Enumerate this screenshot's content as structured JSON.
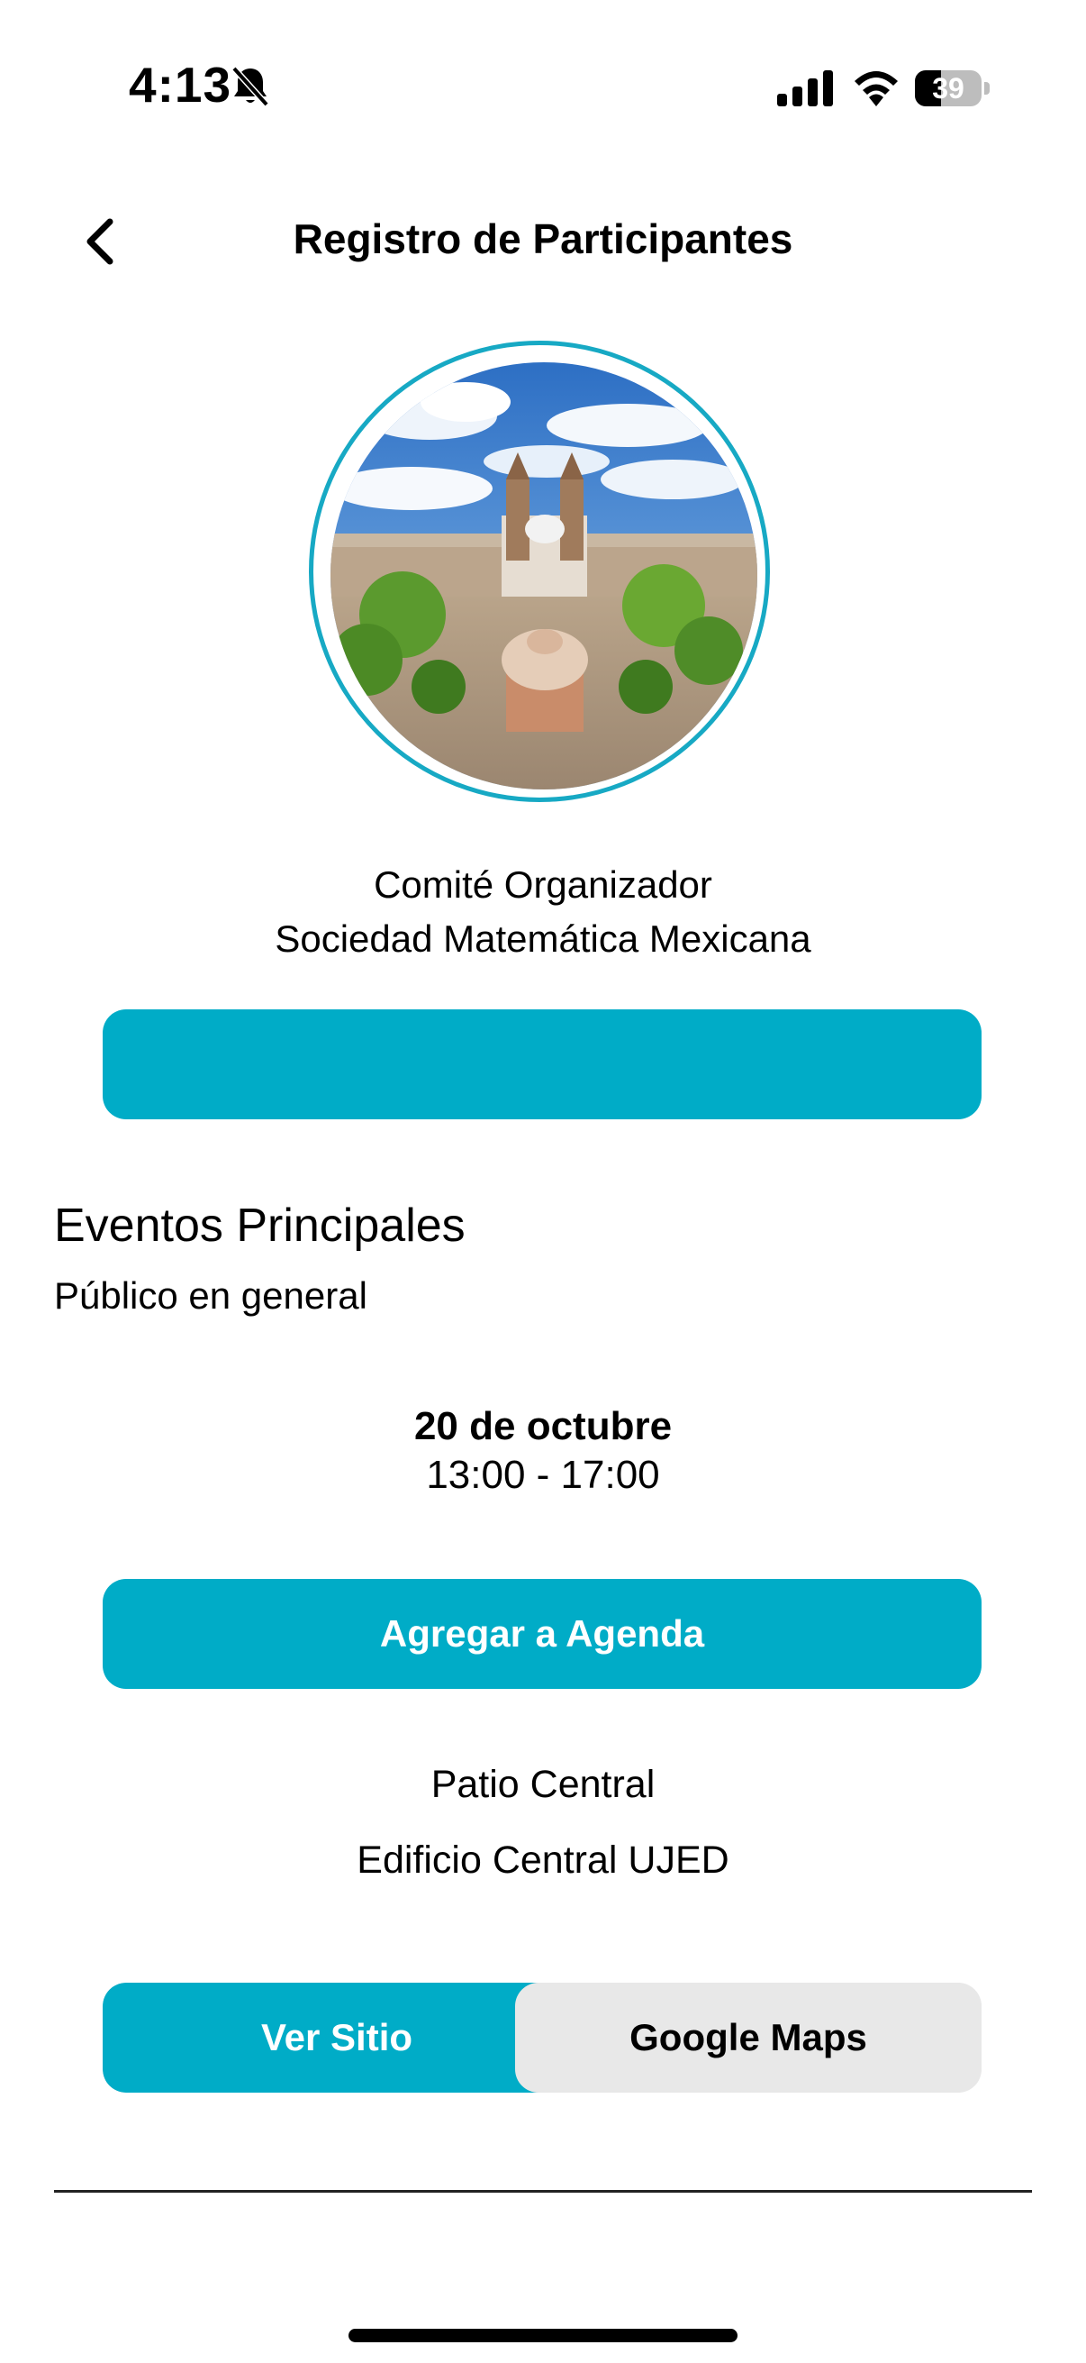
{
  "status_bar": {
    "time": "4:13",
    "battery_percent": "39",
    "battery_level": 0.39,
    "icons": [
      "bell-slash-icon",
      "cellular-signal-icon",
      "wifi-icon",
      "battery-icon"
    ]
  },
  "header": {
    "title": "Registro de Participantes",
    "back_icon": "chevron-left-icon"
  },
  "organizer": {
    "line1": "Comité Organizador",
    "line2": "Sociedad Matemática Mexicana"
  },
  "primary_button": {
    "label": ""
  },
  "section": {
    "title": "Eventos Principales",
    "subtitle": "Público en general"
  },
  "event": {
    "date": "20 de octubre",
    "hours": "13:00 - 17:00",
    "agenda_label": "Agregar a Agenda"
  },
  "location": {
    "place": "Patio Central",
    "building": "Edificio Central UJED"
  },
  "actions": {
    "site_label": "Ver Sitio",
    "maps_label": "Google Maps"
  },
  "colors": {
    "accent": "#00acc7",
    "ring": "#17a9c4",
    "segment_inactive": "#e8e8e8"
  }
}
